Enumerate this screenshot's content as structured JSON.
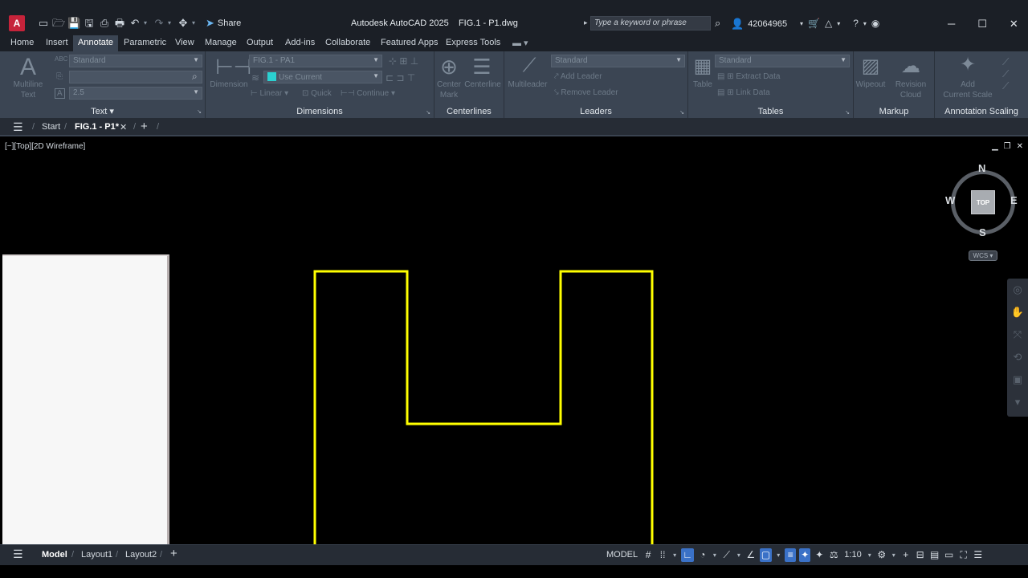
{
  "titlebar": {
    "logo": "A",
    "share_label": "Share",
    "app_name": "Autodesk AutoCAD 2025",
    "file_name": "FIG.1 - P1.dwg",
    "search_placeholder": "Type a keyword or phrase",
    "user_id": "42064965",
    "icons": [
      "new-icon",
      "open-icon",
      "save-icon",
      "saveas-icon",
      "publish-icon",
      "plot-icon",
      "undo-icon",
      "redo-icon",
      "move-icon"
    ]
  },
  "ribbon_tabs": [
    "Home",
    "Insert",
    "Annotate",
    "Parametric",
    "View",
    "Manage",
    "Output",
    "Add-ins",
    "Collaborate",
    "Featured Apps",
    "Express Tools"
  ],
  "active_tab": "Annotate",
  "ribbon": {
    "text": {
      "title": "Text",
      "multiline_label_1": "Multiline",
      "multiline_label_2": "Text",
      "style": "Standard",
      "find_value": "",
      "height": "2.5"
    },
    "dimensions": {
      "title": "Dimensions",
      "dimension_label": "Dimension",
      "style": "FIG.1 - PA1",
      "layer": "Use Current",
      "linear": "Linear",
      "quick": "Quick",
      "continue": "Continue"
    },
    "centerlines": {
      "title": "Centerlines",
      "center_mark_1": "Center",
      "center_mark_2": "Mark",
      "centerline": "Centerline"
    },
    "leaders": {
      "title": "Leaders",
      "multileader": "Multileader",
      "style": "Standard",
      "add_leader": "Add Leader",
      "remove_leader": "Remove Leader"
    },
    "tables": {
      "title": "Tables",
      "table": "Table",
      "style": "Standard",
      "extract_data": "Extract Data",
      "link_data": "Link Data"
    },
    "markup": {
      "title": "Markup",
      "wipeout": "Wipeout",
      "revision_1": "Revision",
      "revision_2": "Cloud"
    },
    "annotation_scaling": {
      "title": "Annotation Scaling",
      "add_1": "Add",
      "add_2": "Current Scale"
    }
  },
  "file_tabs": {
    "start": "Start",
    "active": "FIG.1 - P1*"
  },
  "viewport": {
    "label": "[−][Top][2D Wireframe]",
    "viewcube": {
      "top": "TOP",
      "n": "N",
      "s": "S",
      "e": "E",
      "w": "W"
    },
    "wcs": "WCS"
  },
  "drawing": {
    "stroke_color": "#ffff00",
    "shape": "U-shaped profile polyline"
  },
  "statusbar": {
    "tabs": [
      "Model",
      "Layout1",
      "Layout2"
    ],
    "active": "Model",
    "model_label": "MODEL",
    "scale": "1:10"
  }
}
